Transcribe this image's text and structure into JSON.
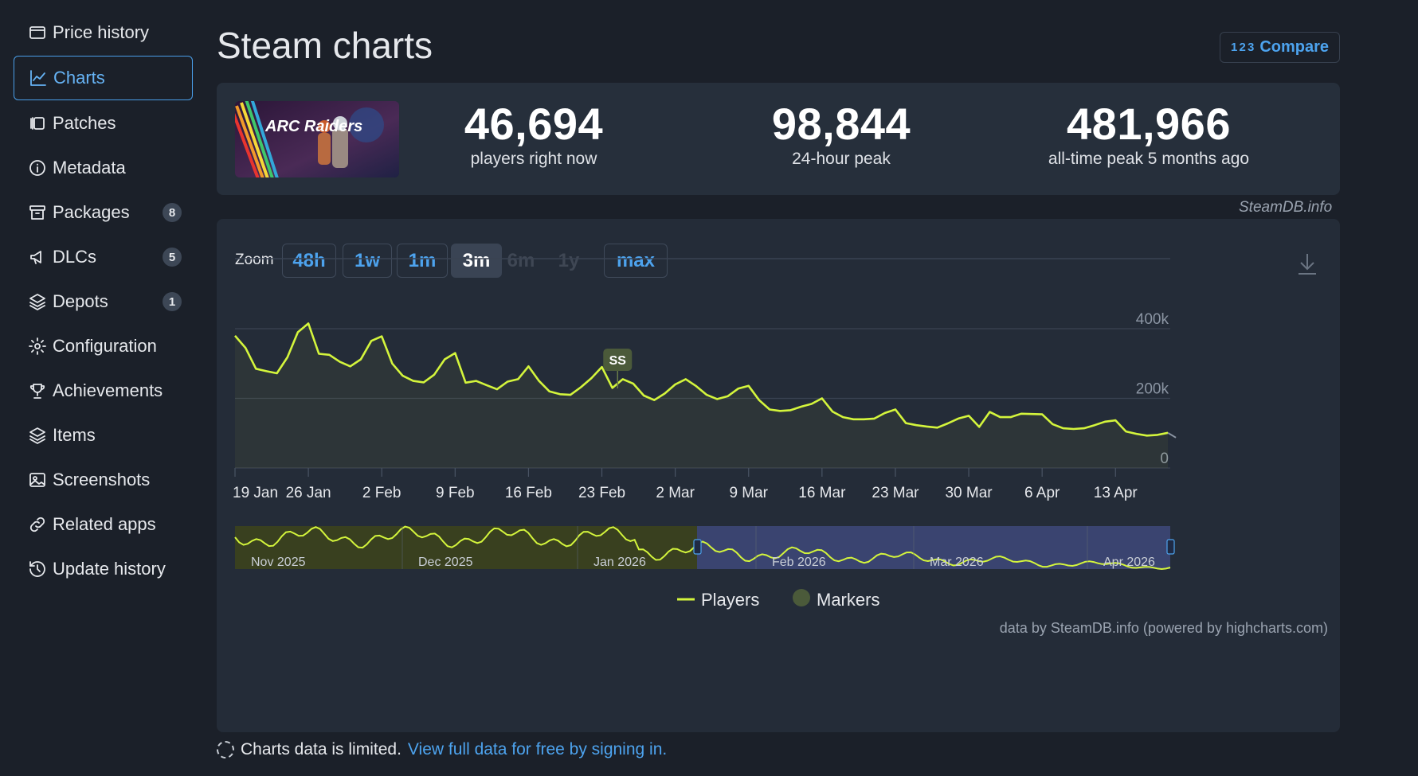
{
  "sidebar": {
    "items": [
      {
        "label": "Price history",
        "icon": "price-history-icon"
      },
      {
        "label": "Charts",
        "icon": "line-chart-icon",
        "active": true
      },
      {
        "label": "Patches",
        "icon": "patches-icon"
      },
      {
        "label": "Metadata",
        "icon": "info-icon"
      },
      {
        "label": "Packages",
        "icon": "package-icon",
        "badge": "8"
      },
      {
        "label": "DLCs",
        "icon": "dlc-icon",
        "badge": "5"
      },
      {
        "label": "Depots",
        "icon": "layers-icon",
        "badge": "1"
      },
      {
        "label": "Configuration",
        "icon": "gear-icon"
      },
      {
        "label": "Achievements",
        "icon": "trophy-icon"
      },
      {
        "label": "Items",
        "icon": "layers-icon"
      },
      {
        "label": "Screenshots",
        "icon": "image-icon"
      },
      {
        "label": "Related apps",
        "icon": "link-icon"
      },
      {
        "label": "Update history",
        "icon": "history-icon"
      }
    ]
  },
  "header": {
    "title": "Steam charts",
    "compare_label": "Compare",
    "compare_icon_text": "1 2 3"
  },
  "stats": {
    "game_image_text": "ARC Raiders",
    "current": {
      "value": "46,694",
      "label": "players right now"
    },
    "peak24": {
      "value": "98,844",
      "label": "24-hour peak"
    },
    "alltime": {
      "value": "481,966",
      "label": "all-time peak 5 months ago"
    }
  },
  "credit_top": "SteamDB.info",
  "zoom": {
    "label": "Zoom",
    "buttons": [
      {
        "label": "48h",
        "state": "normal"
      },
      {
        "label": "1w",
        "state": "normal"
      },
      {
        "label": "1m",
        "state": "normal"
      },
      {
        "label": "3m",
        "state": "active"
      },
      {
        "label": "6m",
        "state": "disabled"
      },
      {
        "label": "1y",
        "state": "disabled"
      },
      {
        "label": "max",
        "state": "normal"
      }
    ]
  },
  "chart_data": {
    "type": "line",
    "ylim": [
      0,
      480000
    ],
    "y_ticks": [
      0,
      200000,
      400000
    ],
    "y_tick_labels": [
      "0",
      "200k",
      "400k"
    ],
    "x_tick_labels": [
      "19 Jan",
      "26 Jan",
      "2 Feb",
      "9 Feb",
      "16 Feb",
      "23 Feb",
      "2 Mar",
      "9 Mar",
      "16 Mar",
      "23 Mar",
      "30 Mar",
      "6 Apr",
      "13 Apr"
    ],
    "x_tick_days": [
      0,
      7,
      14,
      21,
      28,
      35,
      42,
      49,
      56,
      63,
      70,
      77,
      84
    ],
    "x_range_days": [
      0,
      90
    ],
    "series": [
      {
        "name": "Players",
        "color": "#d4f53c",
        "x_days": [
          0,
          1,
          2,
          3,
          4,
          5,
          6,
          7,
          8,
          9,
          10,
          11,
          12,
          13,
          14,
          15,
          16,
          17,
          18,
          19,
          20,
          21,
          22,
          23,
          24,
          25,
          26,
          27,
          28,
          29,
          30,
          31,
          32,
          33,
          34,
          35,
          36,
          37,
          38,
          39,
          40,
          41,
          42,
          43,
          44,
          45,
          46,
          47,
          48,
          49,
          50,
          51,
          52,
          53,
          54,
          55,
          56,
          57,
          58,
          59,
          60,
          61,
          62,
          63,
          64,
          65,
          66,
          67,
          68,
          69,
          70,
          71,
          72,
          73,
          74,
          75,
          76,
          77,
          78,
          79,
          80,
          81,
          82,
          83,
          84,
          85,
          86,
          87,
          88,
          89
        ],
        "values": [
          380000,
          345000,
          285000,
          278000,
          272000,
          318000,
          390000,
          415000,
          328000,
          325000,
          305000,
          292000,
          312000,
          365000,
          378000,
          300000,
          265000,
          250000,
          246000,
          268000,
          312000,
          330000,
          245000,
          250000,
          238000,
          226000,
          248000,
          255000,
          292000,
          250000,
          220000,
          212000,
          210000,
          232000,
          258000,
          290000,
          230000,
          255000,
          242000,
          208000,
          195000,
          214000,
          240000,
          255000,
          235000,
          210000,
          198000,
          206000,
          228000,
          236000,
          195000,
          168000,
          164000,
          166000,
          176000,
          184000,
          200000,
          162000,
          146000,
          140000,
          140000,
          142000,
          158000,
          168000,
          129000,
          123000,
          119000,
          116000,
          128000,
          142000,
          150000,
          118000,
          161000,
          146000,
          146000,
          156000,
          155000,
          154000,
          126000,
          114000,
          112000,
          114000,
          123000,
          133000,
          137000,
          105000,
          98000,
          93000,
          95000,
          101000
        ]
      }
    ],
    "annotation": {
      "label": "SS",
      "x_day": 36.5
    },
    "navigator": {
      "labels": [
        "Nov 2025",
        "Dec 2025",
        "Jan 2026",
        "Feb 2026",
        "Mar 2026",
        "Apr 2026"
      ]
    },
    "legend": [
      {
        "label": "Players",
        "color": "#d4f53c"
      },
      {
        "label": "Markers",
        "color": "#4b5a3a"
      }
    ],
    "credit": "data by SteamDB.info (powered by highcharts.com)"
  },
  "footer": {
    "text": "Charts data is limited.",
    "link": "View full data for free by signing in."
  }
}
